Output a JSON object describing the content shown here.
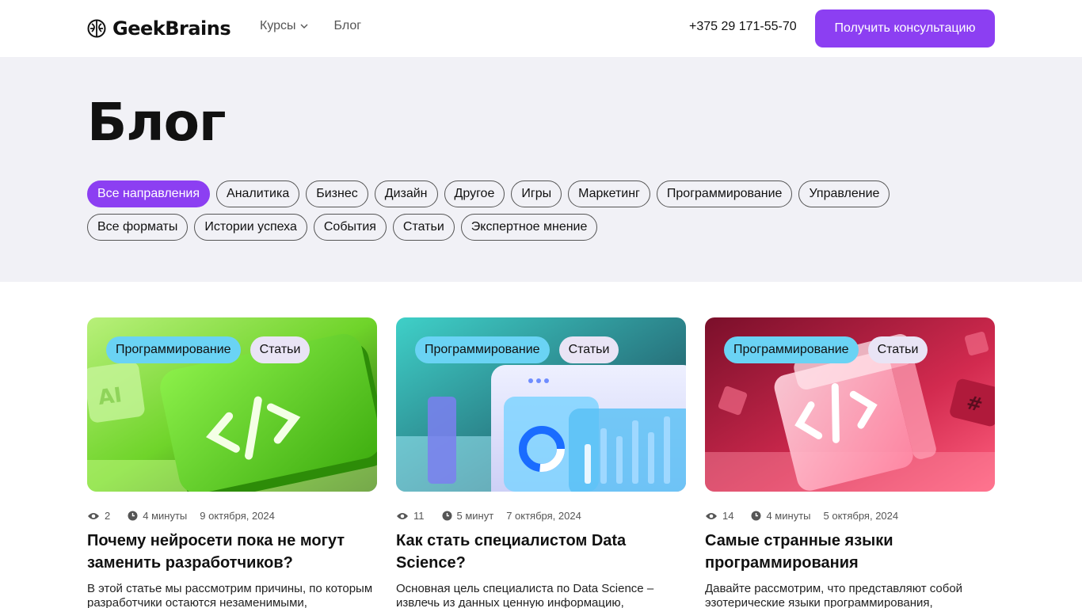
{
  "header": {
    "logo_text": "GeekBrains",
    "nav": [
      {
        "label": "Курсы",
        "has_dropdown": true
      },
      {
        "label": "Блог",
        "has_dropdown": false
      }
    ],
    "phone": "+375 29 171-55-70",
    "cta_label": "Получить консультацию"
  },
  "hero": {
    "title": "Блог",
    "directions": [
      "Все направления",
      "Аналитика",
      "Бизнес",
      "Дизайн",
      "Другое",
      "Игры",
      "Маркетинг",
      "Программирование",
      "Управление"
    ],
    "formats": [
      "Все форматы",
      "Истории успеха",
      "События",
      "Статьи",
      "Экспертное мнение"
    ],
    "active_direction": "Все направления"
  },
  "cards": [
    {
      "tag_direction": "Программирование",
      "tag_format": "Статьи",
      "views": "2",
      "read_time": "4 минуты",
      "date": "9 октября, 2024",
      "title": "Почему нейросети пока не могут заменить разработчиков?",
      "desc": "В этой статье мы рассмотрим причины, по которым разработчики остаются незаменимыми,",
      "image_theme": "green-code"
    },
    {
      "tag_direction": "Программирование",
      "tag_format": "Статьи",
      "views": "11",
      "read_time": "5 минут",
      "date": "7 октября, 2024",
      "title": "Как стать специалистом Data Science?",
      "desc": "Основная цель специалиста по Data Science – извлечь из данных ценную информацию,",
      "image_theme": "blue-dashboard"
    },
    {
      "tag_direction": "Программирование",
      "tag_format": "Статьи",
      "views": "14",
      "read_time": "4 минуты",
      "date": "5 октября, 2024",
      "title": "Самые странные языки программирования",
      "desc": "Давайте рассмотрим, что представляют собой эзотерические языки программирования,",
      "image_theme": "pink-cube"
    }
  ],
  "colors": {
    "accent": "#8c3ff2",
    "hero_bg": "#f1f1f6",
    "tag_direction": "#6ad3f4",
    "tag_format": "#e9e4f5"
  }
}
